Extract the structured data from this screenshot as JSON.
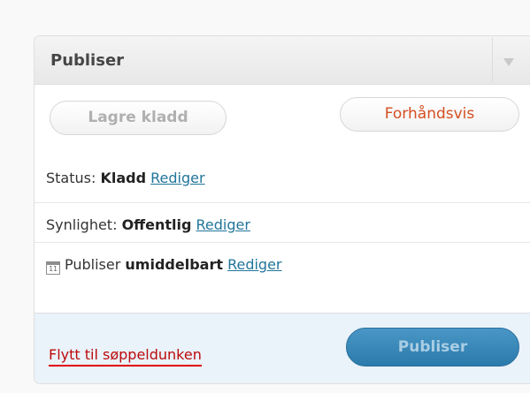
{
  "publish_box": {
    "title": "Publiser",
    "toggle_icon": "triangle-down-icon",
    "save_draft_label": "Lagre kladd",
    "preview_label": "Forhåndsvis",
    "status": {
      "label": "Status:",
      "value": "Kladd",
      "edit": "Rediger"
    },
    "visibility": {
      "label": "Synlighet:",
      "value": "Offentlig",
      "edit": "Rediger"
    },
    "schedule": {
      "icon": "calendar-icon",
      "icon_text": "11",
      "label": "Publiser",
      "value": "umiddelbart",
      "edit": "Rediger"
    },
    "trash_label": "Flytt til søppeldunken",
    "publish_label": "Publiser"
  },
  "colors": {
    "link": "#21759b",
    "trash": "#bc0b0b",
    "preview_text": "#d54e21",
    "publish_button": "#2a7aab",
    "actions_bg": "#eaf2fa"
  }
}
